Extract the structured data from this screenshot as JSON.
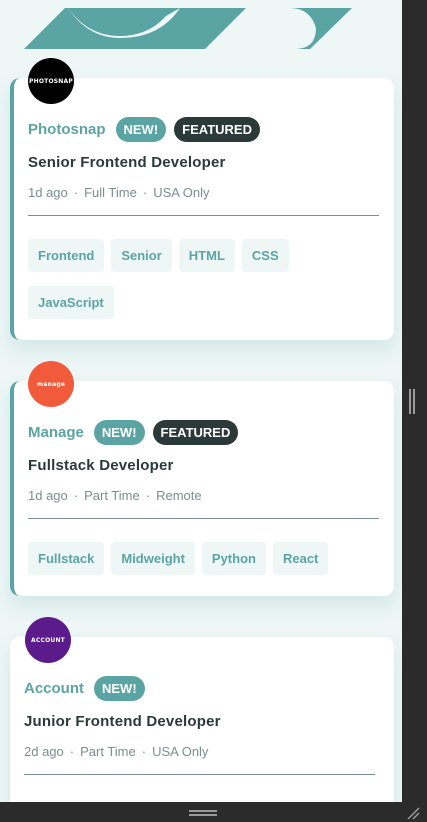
{
  "jobs": [
    {
      "company": "Photosnap",
      "logo_text": "PHOTOSNAP",
      "logo_color": "#000000",
      "new_label": "NEW!",
      "featured_label": "FEATURED",
      "position": "Senior Frontend Developer",
      "posted": "1d ago",
      "contract": "Full Time",
      "location": "USA Only",
      "tags": [
        "Frontend",
        "Senior",
        "HTML",
        "CSS",
        "JavaScript"
      ]
    },
    {
      "company": "Manage",
      "logo_text": "manage",
      "logo_color": "#f15a3a",
      "new_label": "NEW!",
      "featured_label": "FEATURED",
      "position": "Fullstack Developer",
      "posted": "1d ago",
      "contract": "Part Time",
      "location": "Remote",
      "tags": [
        "Fullstack",
        "Midweight",
        "Python",
        "React"
      ]
    },
    {
      "company": "Account",
      "logo_text": "ACCOUNT",
      "logo_color": "#5b1b8a",
      "new_label": "NEW!",
      "position": "Junior Frontend Developer",
      "posted": "2d ago",
      "contract": "Part Time",
      "location": "USA Only"
    }
  ],
  "colors": {
    "primary": "#5ba4a4",
    "dark": "#2b3939",
    "muted": "#7b8e8e",
    "background": "#eef6f6"
  }
}
